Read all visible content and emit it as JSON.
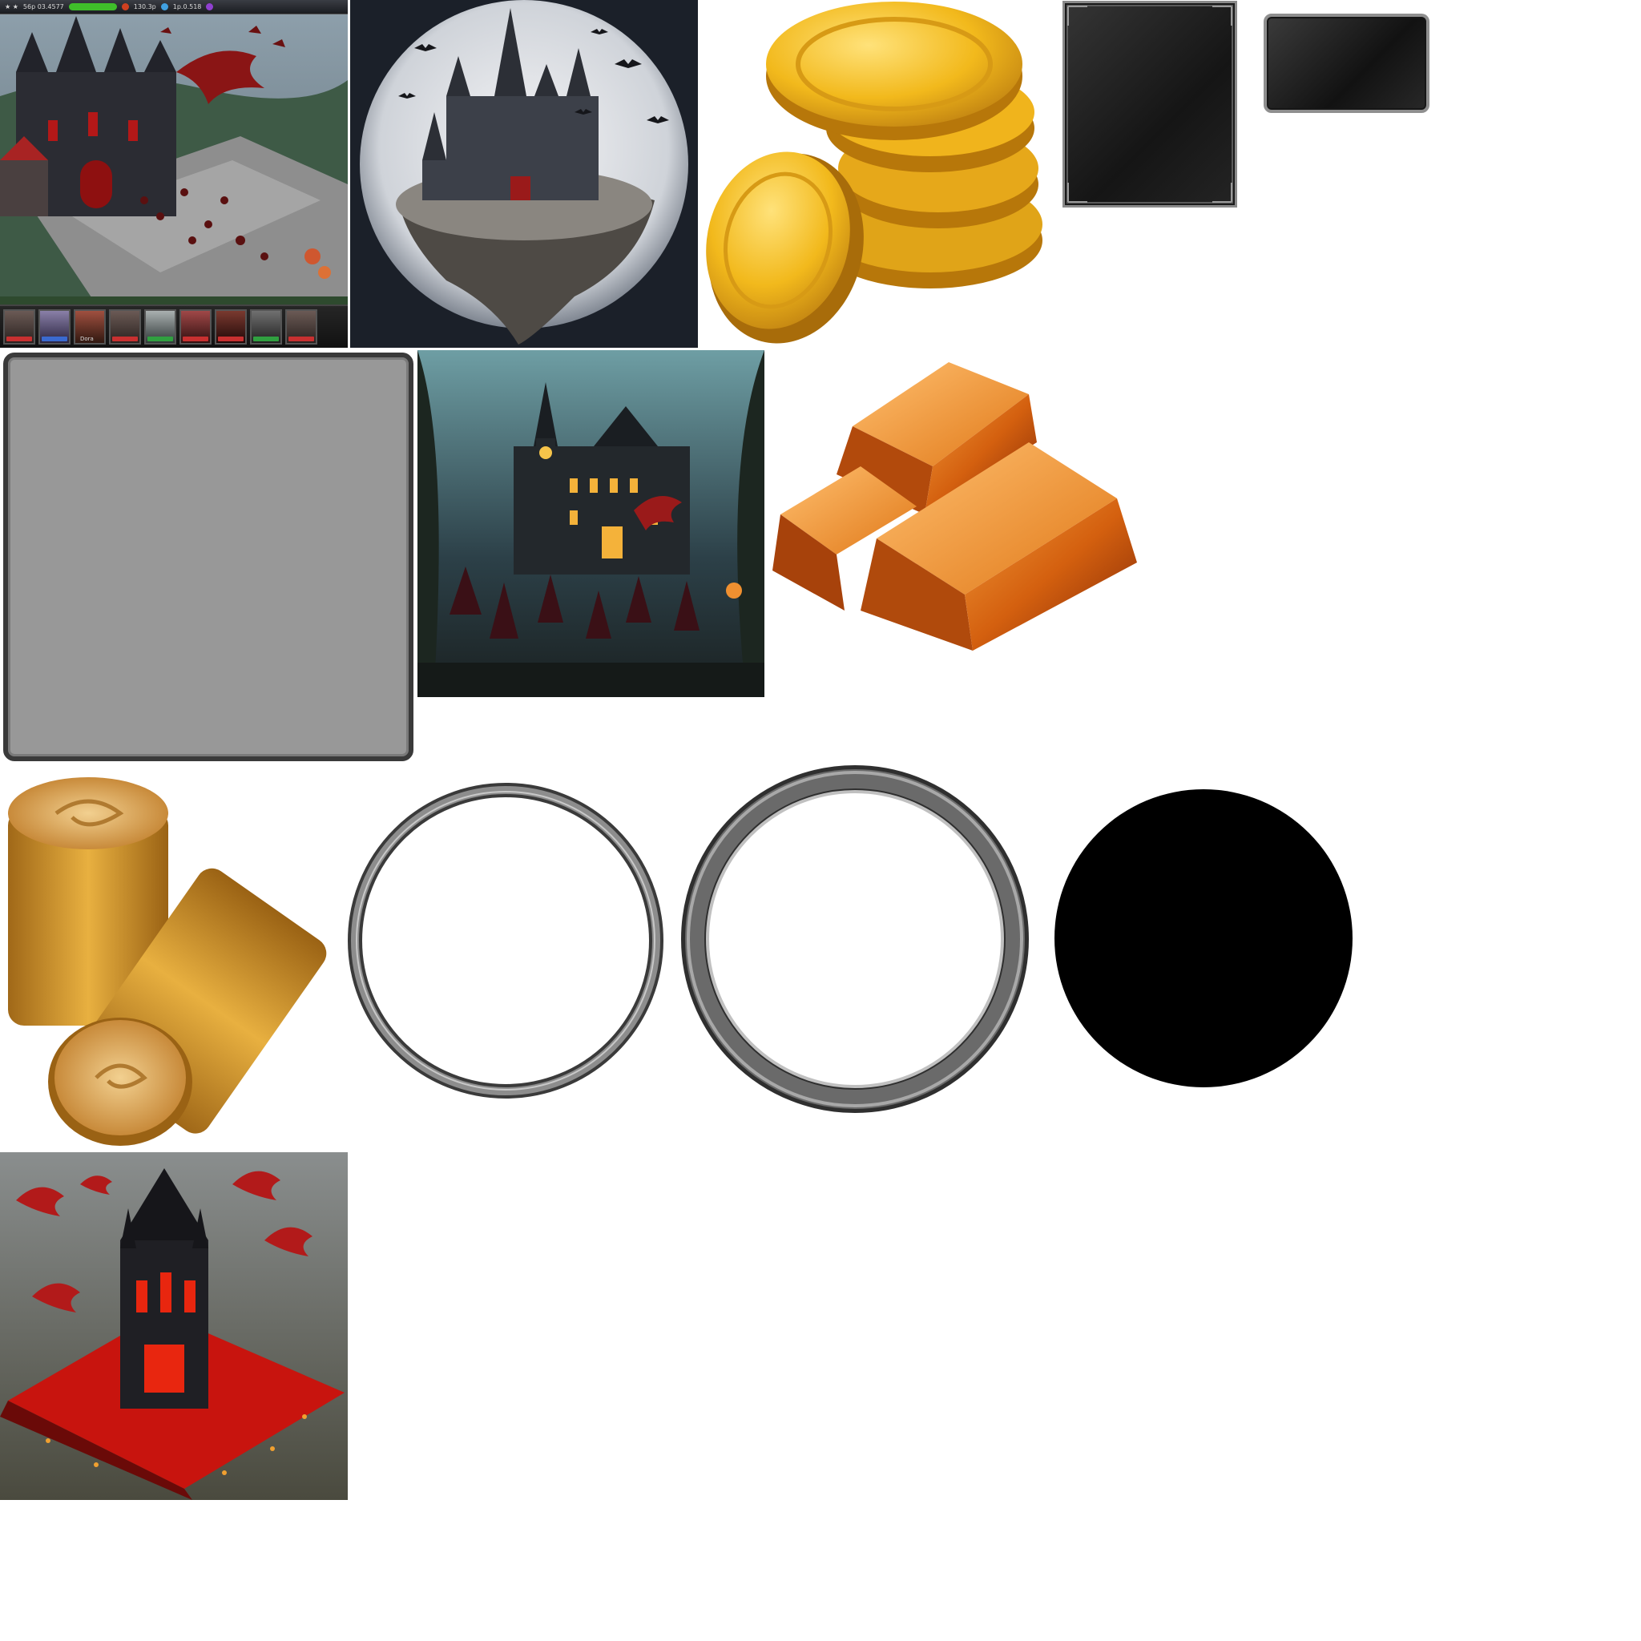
{
  "sheet": {
    "background": "#ffffff",
    "sprites": [
      "castle-screenshot",
      "moon-castle",
      "gold-coins",
      "stone-panel-tall",
      "stone-button-panel",
      "grey-frame",
      "haunted-manor",
      "copper-ingots",
      "wood-logs",
      "silver-ring-thin",
      "silver-ring-thick",
      "black-disc",
      "blood-tower"
    ]
  },
  "castle_screenshot": {
    "topbar": {
      "resource_1": "56p 03.4577",
      "resource_2": "130.3p",
      "resource_3": "1p.0.518"
    },
    "portrait_tags": [
      "#c83030",
      "#3a6ad0",
      "#c8c8c8",
      "#c83030",
      "#30a040",
      "#c83030",
      "#c83030",
      "#30a040",
      "#c83030"
    ],
    "portrait_label": "Dora"
  },
  "colors": {
    "gold": "#f2b91c",
    "gold_dark": "#b7770a",
    "copper": "#d96a14",
    "copper_dark": "#8a2e07",
    "wood": "#e0a63a",
    "wood_dark": "#8b5a15",
    "silver": "#8d8d8d",
    "silver_dark": "#3a3a3a",
    "blood": "#d3150f",
    "moon": "#e4e6ea"
  }
}
